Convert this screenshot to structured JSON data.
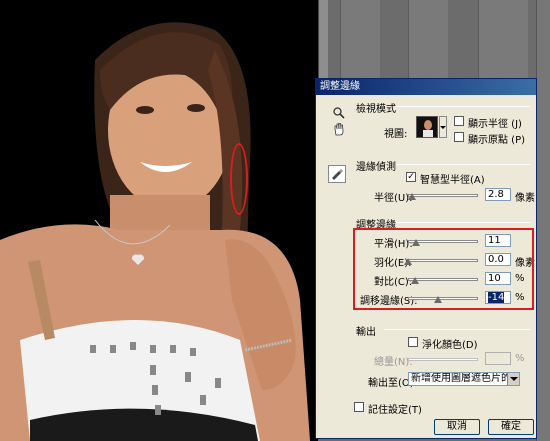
{
  "dialog": {
    "title": "調整邊緣",
    "view_mode": {
      "group_label": "檢視模式",
      "view_label": "視圖:",
      "show_radius_label": "顯示半徑 (J)",
      "show_original_label": "顯示原點 (P)",
      "show_radius_checked": false,
      "show_original_checked": false
    },
    "edge_detection": {
      "group_label": "邊緣偵測",
      "smart_radius_label": "智慧型半徑(A)",
      "smart_radius_checked": true,
      "radius_label": "半徑(U):",
      "radius_value": "2.8",
      "radius_unit": "像素",
      "radius_level": 0.05
    },
    "adjust_edge": {
      "group_label": "調整邊緣",
      "smooth_label": "平滑(H):",
      "smooth_value": "11",
      "smooth_level": 0.11,
      "feather_label": "羽化(E):",
      "feather_value": "0.0",
      "feather_unit": "像素",
      "feather_level": 0.0,
      "contrast_label": "對比(C):",
      "contrast_value": "10",
      "contrast_unit": "%",
      "contrast_level": 0.1,
      "shift_label": "調移邊緣(S):",
      "shift_value": "-14",
      "shift_unit": "%",
      "shift_level": 0.43
    },
    "output": {
      "group_label": "輸出",
      "decontaminate_label": "淨化顏色(D)",
      "decontaminate_checked": false,
      "amount_label": "總量(N):",
      "amount_unit": "%",
      "output_to_label": "輸出至(O):",
      "output_to_value": "新增使用圖層遮色片的圖層"
    },
    "remember_label": "記住設定(T)",
    "remember_checked": false,
    "cancel_label": "取消",
    "ok_label": "確定"
  },
  "icons": {
    "zoom": "zoom-icon",
    "hand": "hand-icon",
    "refine_brush": "refine-radius-brush-icon"
  },
  "colors": {
    "annotation": "#d42020",
    "title_bar": "#0a246a"
  }
}
